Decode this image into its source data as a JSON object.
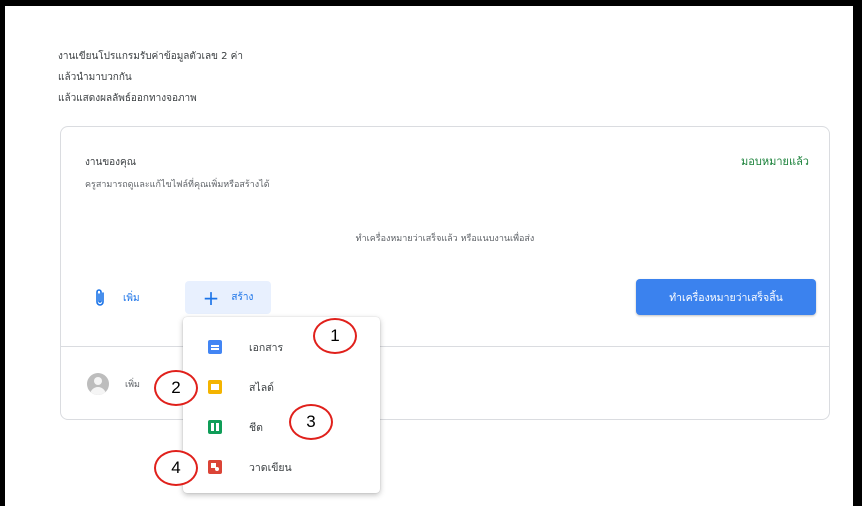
{
  "instructions": [
    "งานเขียนโปรแกรมรับค่าข้อมูลตัวเลข 2 ค่า",
    "แล้วนำมาบวกกัน",
    "แล้วแสดงผลลัพธ์ออกทางจอภาพ"
  ],
  "work": {
    "title": "งานของคุณ",
    "subtitle": "ครูสามารถดูและแก้ไขไฟล์ที่คุณเพิ่มหรือสร้างได้",
    "status": "มอบหมายแล้ว",
    "hint": "ทำเครื่องหมายว่าเสร็จแล้ว หรือแนบงานเพื่อส่ง",
    "add_label": "เพิ่ม",
    "create_label": "สร้าง",
    "create_plus": "+",
    "mark_done_label": "ทำเครื่องหมายว่าเสร็จสิ้น"
  },
  "comment": {
    "placeholder": "เพิ่ม"
  },
  "create_menu": {
    "items": [
      {
        "label": "เอกสาร",
        "icon": "docs-icon"
      },
      {
        "label": "สไลด์",
        "icon": "slides-icon"
      },
      {
        "label": "ชีต",
        "icon": "sheets-icon"
      },
      {
        "label": "วาดเขียน",
        "icon": "drawings-icon"
      }
    ]
  },
  "callouts": [
    "1",
    "2",
    "3",
    "4"
  ],
  "colors": {
    "accent": "#1a73e8",
    "primary_button": "#3b82ee",
    "status_green": "#188038",
    "callout_red": "#e0201b"
  }
}
